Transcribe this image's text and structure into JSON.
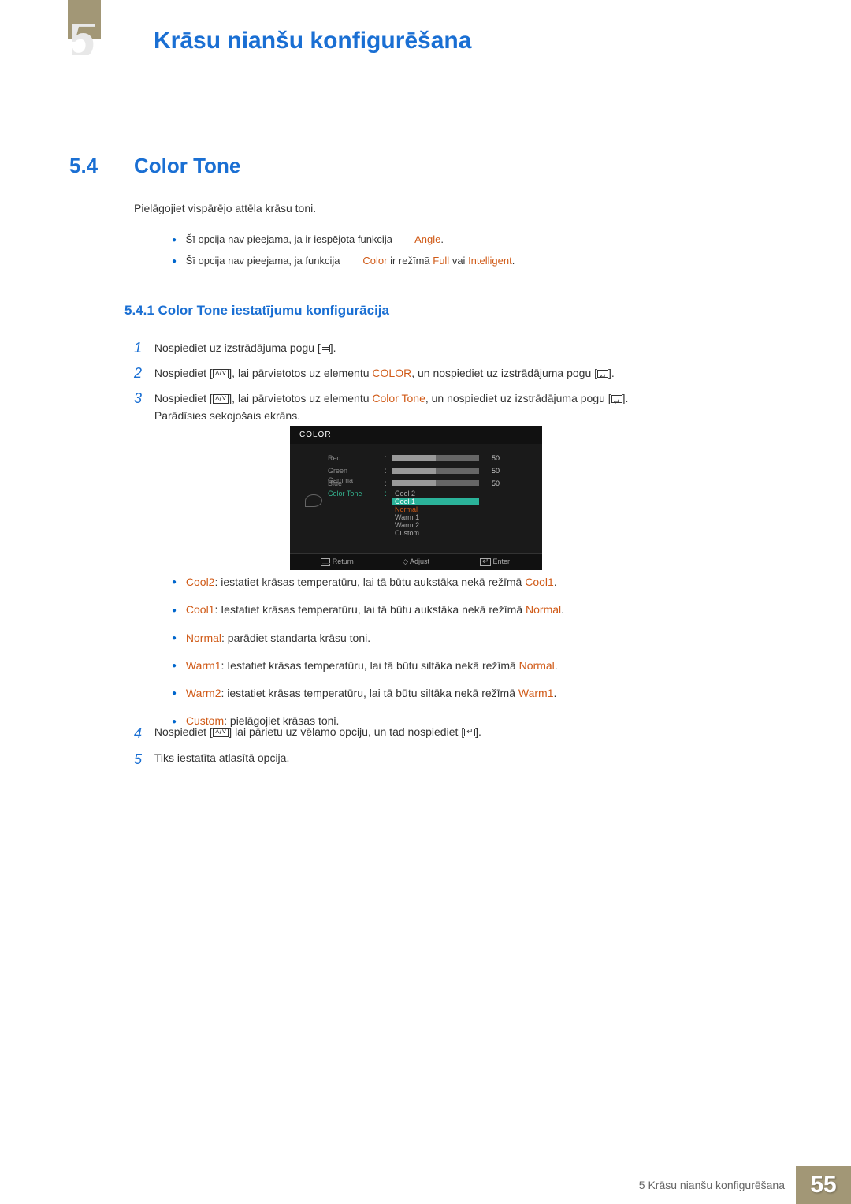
{
  "header": {
    "pageTitle": "Krāsu nianšu konfigurēšana",
    "chapterGlyph": "5"
  },
  "section": {
    "num": "5.4",
    "title": "Color Tone"
  },
  "intro": "Pielāgojiet vispārējo attēla krāsu toni.",
  "notes": [
    {
      "prefix": "Šī opcija nav pieejama, ja ir iespējota funkcija ",
      "hl": "",
      "mid": "",
      "highlights": [
        "Angle"
      ],
      "suffix": "."
    },
    {
      "prefix": "Šī opcija nav pieejama, ja funkcija ",
      "h1": "Color",
      "mid1": " ir režīmā ",
      "h2": "Full",
      "mid2": " vai ",
      "h3": "Intelligent",
      "suffix": "."
    }
  ],
  "subsection": "5.4.1  Color Tone iestatījumu konfigurācija",
  "steps": {
    "s1": {
      "num": "1",
      "pre": "Nospiediet uz izstrādājuma pogu [",
      "post": "]."
    },
    "s2": {
      "num": "2",
      "pre": "Nospiediet [",
      "mid": "], lai pārvietotos uz elementu ",
      "hl": "COLOR",
      "mid2": ", un nospiediet uz izstrādājuma pogu [",
      "post": "]."
    },
    "s3": {
      "num": "3",
      "pre": "Nospiediet [",
      "mid": "], lai pārvietotos uz elementu ",
      "hl": "Color Tone",
      "mid2": ", un nospiediet uz izstrādājuma pogu [",
      "post": "]. ",
      "line2": "Parādīsies sekojošais ekrāns."
    },
    "s4": {
      "num": "4",
      "pre": "Nospiediet [",
      "mid": "] lai pārietu uz vēlamo opciju, un tad nospiediet [",
      "post": "]."
    },
    "s5": {
      "num": "5",
      "text": "Tiks iestatīta atlasītā opcija."
    }
  },
  "osd": {
    "title": "COLOR",
    "rows": [
      {
        "label": "Red",
        "val": "50"
      },
      {
        "label": "Green",
        "val": "50"
      },
      {
        "label": "Blue",
        "val": "50"
      }
    ],
    "toneLabel": "Color Tone",
    "gammaLabel": "Gamma",
    "tones": [
      "Cool 2",
      "Cool 1",
      "Normal",
      "Warm 1",
      "Warm 2",
      "Custom"
    ],
    "footer": {
      "ret": "Return",
      "adj": "Adjust",
      "ent": "Enter"
    }
  },
  "descs": [
    {
      "hl": "Cool2",
      "mid": ": iestatiet krāsas temperatūru, lai tā būtu aukstāka nekā režīmā ",
      "hl2": "Cool1",
      "end": "."
    },
    {
      "hl": "Cool1",
      "mid": ": Iestatiet krāsas temperatūru, lai tā būtu aukstāka nekā režīmā ",
      "hl2": "Normal",
      "end": "."
    },
    {
      "hl": "Normal",
      "mid": ": parādiet standarta krāsu toni.",
      "hl2": "",
      "end": ""
    },
    {
      "hl": "Warm1",
      "mid": ": Iestatiet krāsas temperatūru, lai tā būtu siltāka nekā režīmā ",
      "hl2": "Normal",
      "end": "."
    },
    {
      "hl": "Warm2",
      "mid": ": iestatiet krāsas temperatūru, lai tā būtu siltāka nekā režīmā ",
      "hl2": "Warm1",
      "end": "."
    },
    {
      "hl": "Custom",
      "mid": ": pielāgojiet krāsas toni.",
      "hl2": "",
      "end": ""
    }
  ],
  "footer": {
    "text": "5 Krāsu nianšu konfigurēšana",
    "page": "55"
  }
}
